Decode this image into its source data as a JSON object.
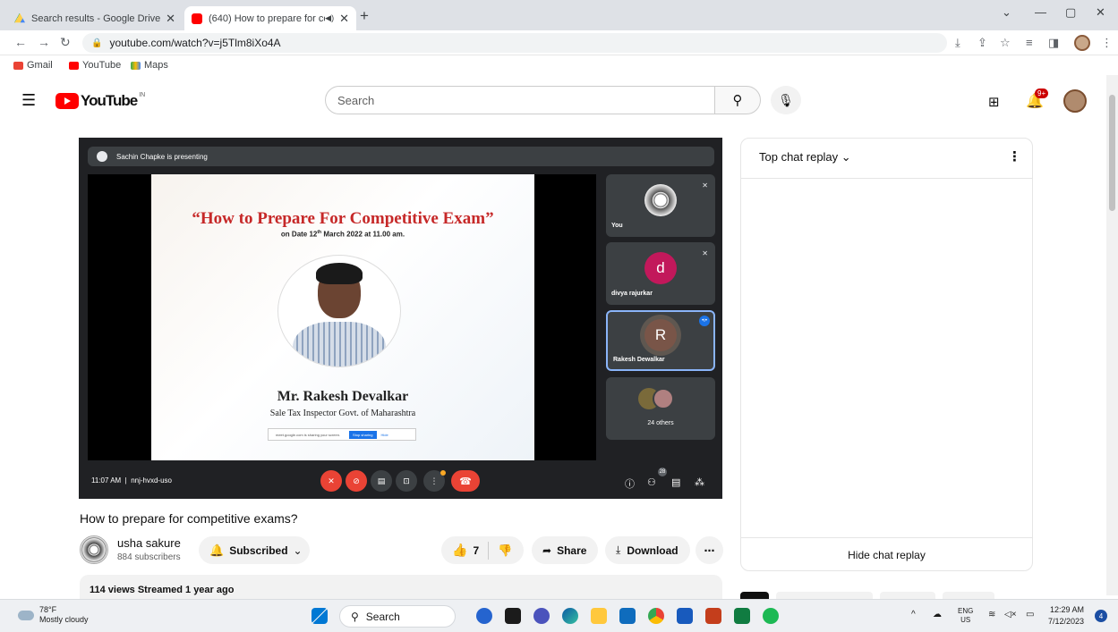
{
  "browser": {
    "tabs": [
      {
        "title": "Search results - Google Drive",
        "favicon_color": "#1fa463"
      },
      {
        "title": "(640) How to prepare for cor",
        "favicon_color": "#ff0000"
      }
    ],
    "url": "youtube.com/watch?v=j5Tlm8iXo4A",
    "bookmarks": [
      {
        "label": "Gmail",
        "color": "#ea4335"
      },
      {
        "label": "YouTube",
        "color": "#ff0000"
      },
      {
        "label": "Maps",
        "color": "#34a853"
      }
    ]
  },
  "youtube": {
    "logo_text": "YouTube",
    "country_code": "IN",
    "search_placeholder": "Search",
    "notifications_badge": "9+"
  },
  "meet": {
    "presenting_label": "Sachin Chapke is presenting",
    "slide": {
      "title": "“How to Prepare For Competitive Exam”",
      "date_prefix": "on Date 12",
      "date_sup": "th",
      "date_suffix": " March 2022 at 11.00 am.",
      "speaker": "Mr. Rakesh Devalkar",
      "role": "Sale Tax Inspector Govt. of Maharashtra",
      "share_notice": "meet.google.com is sharing your screen.",
      "stop_sharing": "Stop sharing",
      "hide": "Hide"
    },
    "participants": [
      {
        "label": "You",
        "initial": ""
      },
      {
        "label": "divya rajurkar",
        "initial": "d",
        "color": "#c2185b"
      },
      {
        "label": "Rakesh Dewalkar",
        "initial": "R",
        "color": "#795548"
      },
      {
        "label": "24 others",
        "initial": ""
      }
    ],
    "time": "11:07 AM",
    "meeting_code": "nnj-hvxd-uso",
    "people_count": "28"
  },
  "video": {
    "title": "How to prepare for competitive exams?",
    "channel_name": "usha sakure",
    "subscribers": "884 subscribers",
    "subscribed_label": "Subscribed",
    "likes": "7",
    "share_label": "Share",
    "download_label": "Download",
    "meta": "114 views  Streamed 1 year ago"
  },
  "chat": {
    "header": "Top chat replay",
    "hide_label": "Hide chat replay"
  },
  "taskbar": {
    "temp": "78°F",
    "weather": "Mostly cloudy",
    "search_label": "Search",
    "lang_top": "ENG",
    "lang_bottom": "US",
    "time": "12:29 AM",
    "date": "7/12/2023",
    "notif_count": "4"
  }
}
